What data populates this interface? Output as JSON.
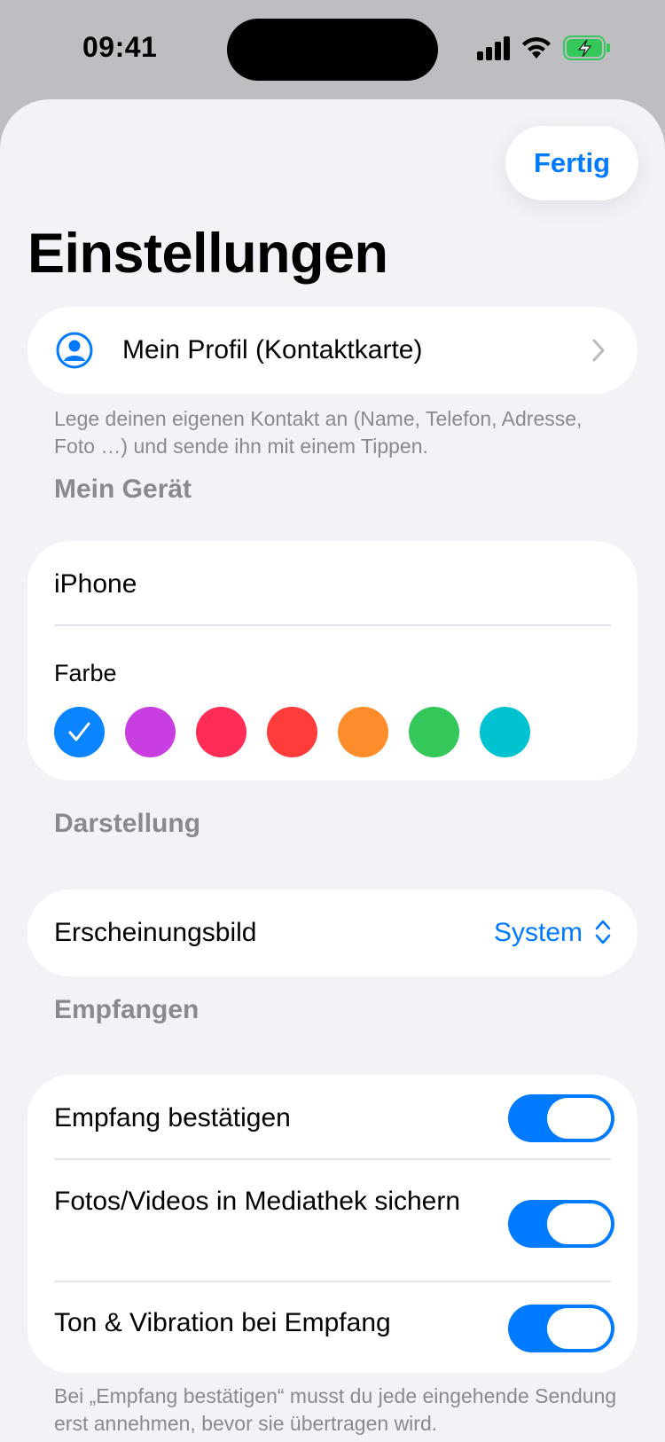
{
  "status": {
    "time": "09:41"
  },
  "header": {
    "done_label": "Fertig",
    "title": "Einstellungen"
  },
  "profile": {
    "label": "Mein Profil (Kontaktkarte)",
    "hint": "Lege deinen eigenen Kontakt an (Name, Telefon, Adresse, Foto …) und sende ihn mit einem Tippen."
  },
  "device": {
    "section_title": "Mein Gerät",
    "name": "iPhone",
    "color_label": "Farbe",
    "colors": [
      "#0a84ff",
      "#c93ee0",
      "#ff2d55",
      "#ff3b3b",
      "#ff8c2a",
      "#34c759",
      "#00c2d1"
    ],
    "selected_color_index": 0
  },
  "appearance": {
    "section_title": "Darstellung",
    "label": "Erscheinungsbild",
    "value": "System"
  },
  "receive": {
    "section_title": "Empfangen",
    "rows": [
      {
        "label": "Empfang bestätigen",
        "on": true
      },
      {
        "label": "Fotos/Videos in Mediathek sichern",
        "on": true
      },
      {
        "label": "Ton & Vibration bei Empfang",
        "on": true
      }
    ],
    "hint": "Bei „Empfang bestätigen“ musst du jede eingehende Sendung erst annehmen, bevor sie übertragen wird."
  },
  "accent_color": "#007aff"
}
